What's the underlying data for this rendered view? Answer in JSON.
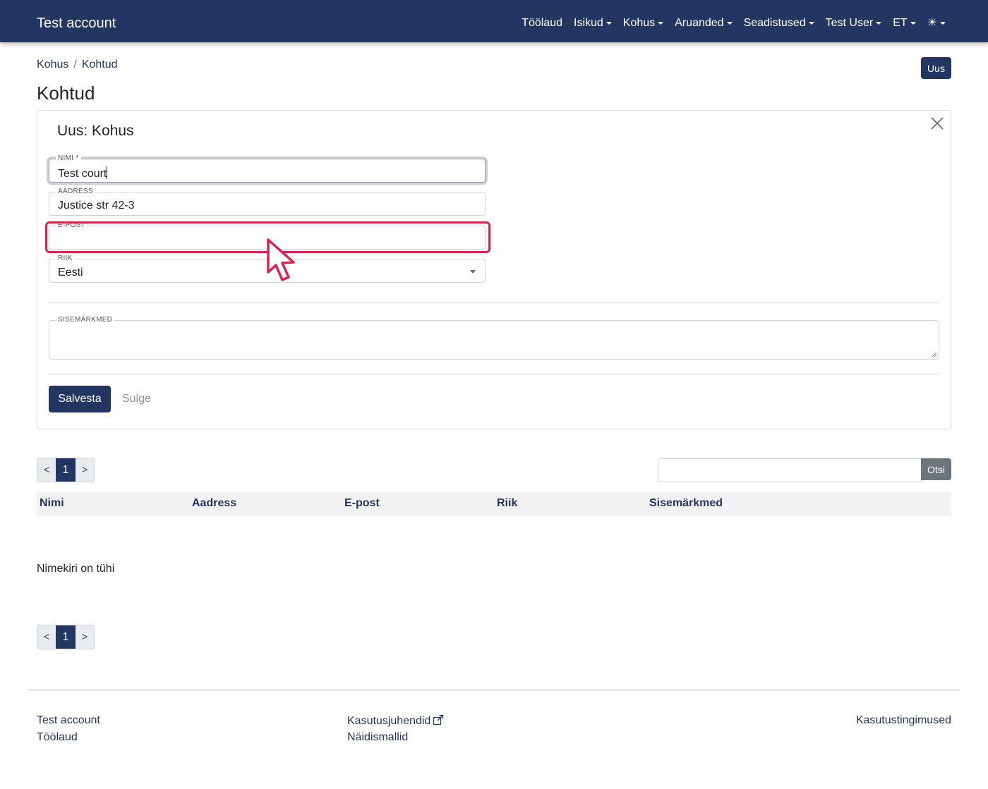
{
  "navbar": {
    "brand": "Test account",
    "items": [
      {
        "label": "Töölaud",
        "dropdown": false
      },
      {
        "label": "Isikud",
        "dropdown": true
      },
      {
        "label": "Kohus",
        "dropdown": true
      },
      {
        "label": "Aruanded",
        "dropdown": true
      },
      {
        "label": "Seadistused",
        "dropdown": true
      },
      {
        "label": "Test User",
        "dropdown": true
      },
      {
        "label": "ET",
        "dropdown": true
      }
    ],
    "theme_icon": "sun-icon",
    "theme_glyph": "☀"
  },
  "breadcrumb": {
    "items": [
      "Kohus",
      "Kohtud"
    ],
    "separator": "/"
  },
  "new_button": "Uus",
  "page_title": "Kohtud",
  "form": {
    "title": "Uus: Kohus",
    "fields": {
      "nimi": {
        "label": "NIMI *",
        "value": "Test court"
      },
      "aadress": {
        "label": "AADRESS",
        "value": "Justice str 42-3"
      },
      "epost": {
        "label": "E-POST",
        "value": ""
      },
      "riik": {
        "label": "RIIK",
        "value": "Eesti"
      },
      "sisemarkmed": {
        "label": "SISEMÄRKMED",
        "value": ""
      }
    },
    "save": "Salvesta",
    "close": "Sulge"
  },
  "pager": {
    "prev": "<",
    "page": "1",
    "next": ">"
  },
  "search": {
    "placeholder": "",
    "button": "Otsi"
  },
  "table": {
    "columns": [
      "Nimi",
      "Aadress",
      "E-post",
      "Riik",
      "Sisemärkmed"
    ],
    "empty": "Nimekiri on tühi"
  },
  "footer": {
    "col1": [
      "Test account",
      "Töölaud"
    ],
    "col2": [
      "Kasutusjuhendid",
      "Näidismallid"
    ],
    "col3": [
      "Kasutustingimused"
    ]
  },
  "colors": {
    "primary": "#233662",
    "secondary": "#6c757d",
    "highlight": "#d6254f"
  }
}
